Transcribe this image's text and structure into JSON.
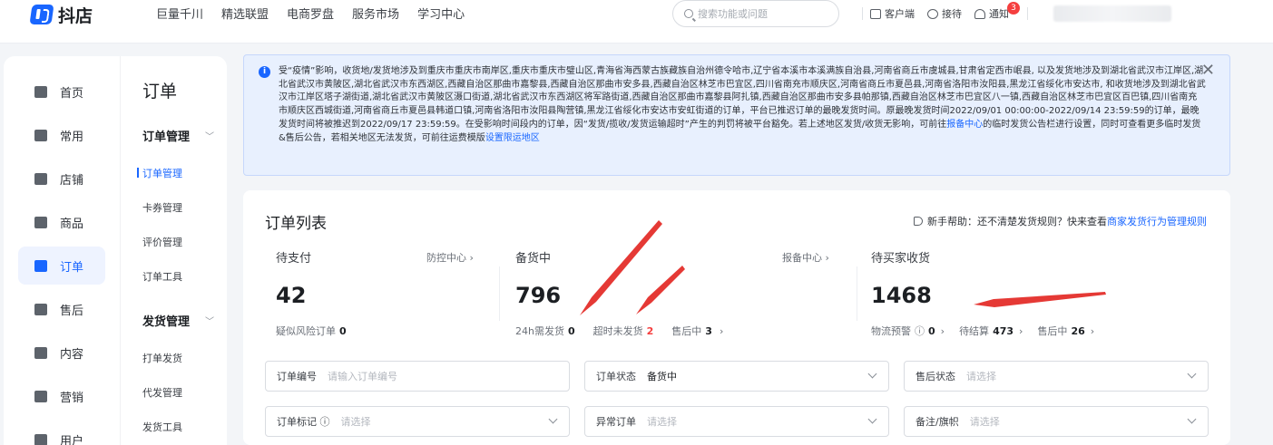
{
  "app": {
    "name": "抖店",
    "brand_color": "#1966ff"
  },
  "topnav": [
    "巨量千川",
    "精选联盟",
    "电商罗盘",
    "服务市场",
    "学习中心"
  ],
  "search": {
    "placeholder": "搜索功能或问题"
  },
  "topright": {
    "client": "客户端",
    "reception": "接待",
    "notify": "通知",
    "notify_count": "3"
  },
  "sidebar": [
    {
      "label": "首页",
      "icon": "home-icon"
    },
    {
      "label": "常用",
      "icon": "apps-icon"
    },
    {
      "label": "店铺",
      "icon": "shop-icon"
    },
    {
      "label": "商品",
      "icon": "product-icon"
    },
    {
      "label": "订单",
      "icon": "order-icon",
      "active": true
    },
    {
      "label": "售后",
      "icon": "aftersale-icon"
    },
    {
      "label": "内容",
      "icon": "content-icon"
    },
    {
      "label": "营销",
      "icon": "marketing-icon"
    },
    {
      "label": "用户",
      "icon": "user-icon"
    }
  ],
  "subnav": {
    "title": "订单",
    "group1": "订单管理",
    "group1_items": [
      "订单管理",
      "卡券管理",
      "评价管理",
      "订单工具"
    ],
    "group2": "发货管理",
    "group2_items": [
      "打单发货",
      "代发管理",
      "发货工具"
    ]
  },
  "notice": {
    "text": "受“疫情”影响，收货地/发货地涉及到重庆市重庆市南岸区,重庆市重庆市璧山区,青海省海西蒙古族藏族自治州德令哈市,辽宁省本溪市本溪满族自治县,河南省商丘市虞城县,甘肃省定西市岷县, 以及发货地涉及到湖北省武汉市江岸区,湖北省武汉市黄陂区,湖北省武汉市东西湖区,西藏自治区那曲市嘉黎县,西藏自治区那曲市安多县,西藏自治区林芝市巴宜区,四川省南充市顺庆区,河南省商丘市夏邑县,河南省洛阳市汝阳县,黑龙江省绥化市安达市, 和收货地涉及到湖北省武汉市江岸区塔子湖街道,湖北省武汉市黄陂区滠口街道,湖北省武汉市东西湖区将军路街道,西藏自治区那曲市嘉黎县阿扎镇,西藏自治区那曲市安多县帕那镇,西藏自治区林芝市巴宜区八一镇,西藏自治区林芝市巴宜区百巴镇,四川省南充市顺庆区西城街道,河南省商丘市夏邑县韩道口镇,河南省洛阳市汝阳县陶营镇,黑龙江省绥化市安达市安虹街道的订单，平台已推迟订单的最晚发货时间。原最晚发货时间2022/09/01 00:00:00-2022/09/14 23:59:59的订单，最晚发货时间将被推迟到2022/09/17 23:59:59。在受影响时间段内的订单，因“发货/揽收/发货运输超时”产生的判罚将被平台豁免。若上述地区发货/收货无影响，可前往",
    "link1": "报备中心",
    "text2": "的临时发货公告栏进行设置，同时可查看更多临时发货&售后公告，若相关地区无法发货，可前往运费模版",
    "link2": "设置限运地区"
  },
  "card": {
    "title": "订单列表",
    "help_prefix": "新手帮助：还不清楚发货规则？快来查看",
    "help_link": "商家发货行为管理规则"
  },
  "stats": {
    "pending_pay": {
      "label": "待支付",
      "value": "42",
      "link": "防控中心",
      "sub_label": "疑似风险订单",
      "sub_value": "0"
    },
    "stocking": {
      "label": "备货中",
      "value": "796",
      "link": "报备中心",
      "sub1_label": "24h需发货",
      "sub1_value": "0",
      "sub2_label": "超时未发货",
      "sub2_value": "2",
      "sub3_label": "售后中",
      "sub3_value": "3"
    },
    "awaiting": {
      "label": "待买家收货",
      "value": "1468",
      "sub1_label": "物流预警",
      "sub1_value": "0",
      "sub2_label": "待结算",
      "sub2_value": "473",
      "sub3_label": "售后中",
      "sub3_value": "26"
    }
  },
  "filters": {
    "order_no": {
      "label": "订单编号",
      "placeholder": "请输入订单编号"
    },
    "order_status": {
      "label": "订单状态",
      "value": "备货中"
    },
    "aftersale_status": {
      "label": "售后状态",
      "placeholder": "请选择"
    },
    "order_mark": {
      "label": "订单标记",
      "placeholder": "请选择"
    },
    "abnormal": {
      "label": "异常订单",
      "placeholder": "请选择"
    },
    "remark": {
      "label": "备注/旗帜",
      "placeholder": "请选择"
    }
  },
  "annotation_color": "#e53935"
}
